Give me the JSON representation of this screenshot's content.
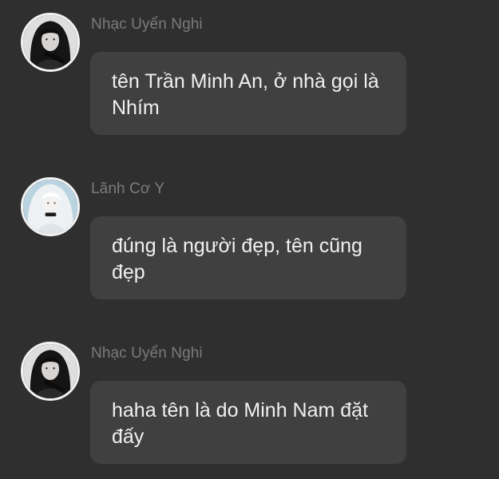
{
  "messages": [
    {
      "sender": "Nhạc Uyển Nghi",
      "avatar_icon": "dark-haired-woman-avatar-icon",
      "text": "tên Trần Minh An, ở nhà gọi là Nhím"
    },
    {
      "sender": "Lãnh Cơ Y",
      "avatar_icon": "white-haired-woman-avatar-icon",
      "text": "đúng là người đẹp, tên cũng đẹp"
    },
    {
      "sender": "Nhạc Uyển Nghi",
      "avatar_icon": "dark-haired-woman-avatar-icon",
      "text": "haha tên là do Minh Nam đặt đấy"
    }
  ],
  "colors": {
    "background": "#2f2f2f",
    "bubble": "#404040",
    "sender_name": "#7b7b7b",
    "message_text": "#f0f0f0",
    "avatar_border": "#f2f2f2"
  }
}
